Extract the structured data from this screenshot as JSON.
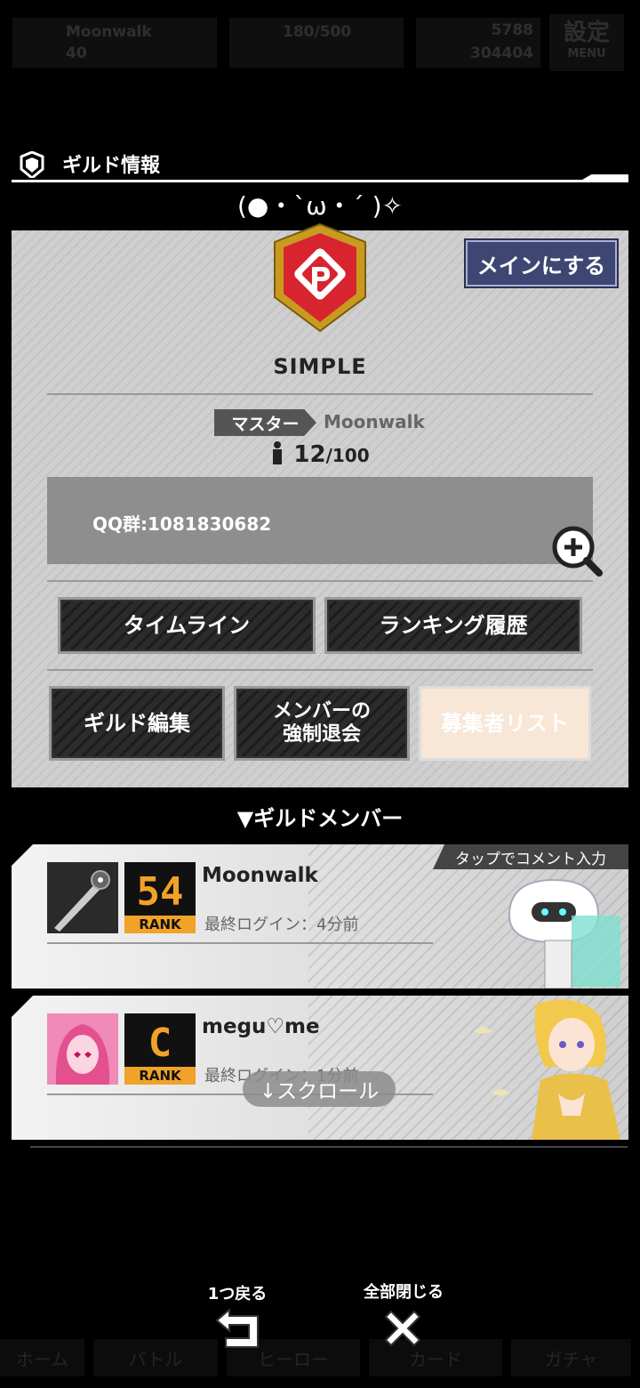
{
  "status_bar": {
    "player_name": "Moonwalk",
    "level": "40",
    "stamina": "180/500",
    "currency_top": "5788",
    "currency_bottom": "304404",
    "settings_label": "設定",
    "menu_label": "MENU"
  },
  "header": {
    "title": "ギルド情報",
    "motto": "(●・`ω・´ )✧"
  },
  "guild": {
    "set_main_button": "メインにする",
    "name": "SIMPLE",
    "master_label": "マスター",
    "master_name": "Moonwalk",
    "member_count": "12",
    "member_max": "/100",
    "description": "QQ群:1081830682"
  },
  "actions": {
    "timeline": "タイムライン",
    "ranking_history": "ランキング履歴",
    "edit_guild": "ギルド編集",
    "force_leave_line1": "メンバーの",
    "force_leave_line2": "強制退会",
    "applicant_list": "募集者リスト"
  },
  "members_section": {
    "title": "▼ギルドメンバー",
    "tap_hint": "タップでコメント入力",
    "members": [
      {
        "name": "Moonwalk",
        "rank": "54",
        "rank_label": "RANK",
        "last_login": "最終ログイン：4分前"
      },
      {
        "name": "megu♡me",
        "rank": "C",
        "rank_label": "RANK",
        "last_login": "最終ログイン：1分前"
      }
    ],
    "scroll_hint": "↓スクロール"
  },
  "bottom_nav": {
    "back_label": "1つ戻る",
    "close_all_label": "全部閉じる",
    "tabs": [
      "ホーム",
      "バトル",
      "ヒーロー",
      "カード",
      "ガチャ"
    ]
  },
  "colors": {
    "panel_bg": "#c9c9c9",
    "main_button": "#3e4773",
    "rank_gold": "#f1a228",
    "emblem_red": "#d8242f",
    "emblem_gold": "#c89a1f"
  }
}
